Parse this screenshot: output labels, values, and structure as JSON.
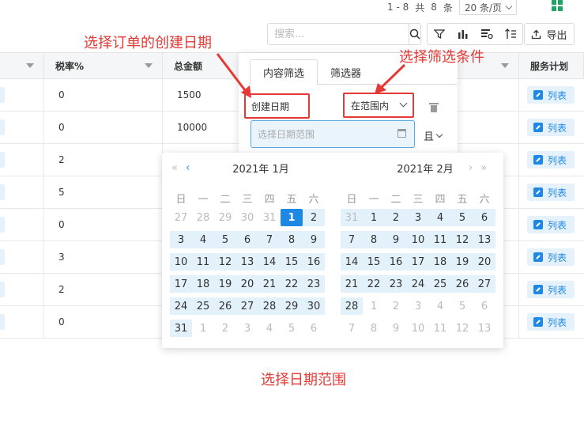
{
  "pager": {
    "range": "1 - 8",
    "total_prefix": "共",
    "total": "8",
    "total_suffix": "条",
    "page_size": "20 条/页"
  },
  "toolbar": {
    "search_placeholder": "搜索...",
    "export_label": "导出"
  },
  "table": {
    "headers": [
      {
        "label": ""
      },
      {
        "label": "税率%"
      },
      {
        "label": "总金额"
      },
      {
        "label": ""
      },
      {
        "label": "服务计划"
      }
    ],
    "rows": [
      {
        "tax": "0",
        "total": "1500",
        "action": "列表"
      },
      {
        "tax": "0",
        "total": "10000",
        "action": "列表"
      },
      {
        "tax": "2",
        "total": "",
        "action": "列表"
      },
      {
        "tax": "5",
        "total": "",
        "action": "列表"
      },
      {
        "tax": "0",
        "total": "",
        "action": "列表"
      },
      {
        "tax": "3",
        "total": "",
        "action": "列表"
      },
      {
        "tax": "2",
        "total": "",
        "action": "列表"
      },
      {
        "tax": "0",
        "total": "",
        "action": "列表"
      }
    ]
  },
  "filter_panel": {
    "tabs": [
      "内容筛选",
      "筛选器"
    ],
    "field": "创建日期",
    "operator": "在范围内",
    "date_placeholder": "选择日期范围",
    "logic": "且"
  },
  "calendar": {
    "weekdays": [
      "日",
      "一",
      "二",
      "三",
      "四",
      "五",
      "六"
    ],
    "left_title": "2021年 1月",
    "right_title": "2021年 2月",
    "left_days": [
      "27",
      "28",
      "29",
      "30",
      "31",
      "1",
      "2",
      "3",
      "4",
      "5",
      "6",
      "7",
      "8",
      "9",
      "10",
      "11",
      "12",
      "13",
      "14",
      "15",
      "16",
      "17",
      "18",
      "19",
      "20",
      "21",
      "22",
      "23",
      "24",
      "25",
      "26",
      "27",
      "28",
      "29",
      "30",
      "31",
      "1",
      "2",
      "3",
      "4",
      "5",
      "6"
    ],
    "right_days": [
      "31",
      "1",
      "2",
      "3",
      "4",
      "5",
      "6",
      "7",
      "8",
      "9",
      "10",
      "11",
      "12",
      "13",
      "14",
      "15",
      "16",
      "17",
      "18",
      "19",
      "20",
      "21",
      "22",
      "23",
      "24",
      "25",
      "26",
      "27",
      "28",
      "1",
      "2",
      "3",
      "4",
      "5",
      "6",
      "7",
      "8",
      "9",
      "10",
      "11",
      "12",
      "13"
    ],
    "selected": "1",
    "nav_prev_year": "«",
    "nav_prev_month": "‹",
    "nav_next_month": "›",
    "nav_next_year": "»"
  },
  "annotations": {
    "select_date_field": "选择订单的创建日期",
    "select_condition": "选择筛选条件",
    "select_range": "选择日期范围"
  },
  "colors": {
    "accent": "#1e88e5",
    "annotation": "#e53935",
    "range_bg": "#e3f1fb"
  }
}
